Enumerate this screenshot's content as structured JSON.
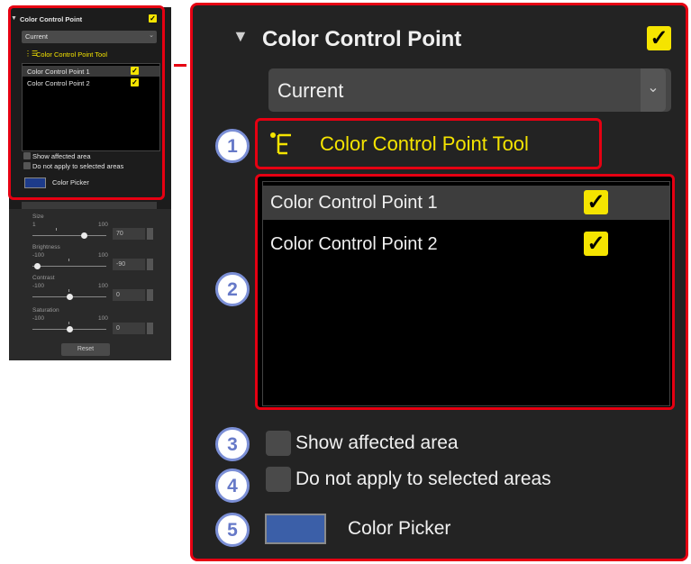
{
  "panel": {
    "title": "Color Control Point",
    "enabled": true,
    "dropdown_value": "Current",
    "tool_label": "Color Control Point Tool",
    "points": [
      {
        "label": "Color Control Point 1",
        "checked": true,
        "selected": true
      },
      {
        "label": "Color Control Point 2",
        "checked": true,
        "selected": false
      }
    ],
    "show_affected_area": "Show affected area",
    "do_not_apply": "Do not apply to selected areas",
    "color_picker_label": "Color Picker",
    "picker_color": "#3b5fa8"
  },
  "sliders": [
    {
      "label": "Size",
      "min": "1",
      "max": "100",
      "value": "70"
    },
    {
      "label": "Brightness",
      "min": "-100",
      "max": "100",
      "value": "-90"
    },
    {
      "label": "Contrast",
      "min": "-100",
      "max": "100",
      "value": "0"
    },
    {
      "label": "Saturation",
      "min": "-100",
      "max": "100",
      "value": "0"
    }
  ],
  "reset_label": "Reset",
  "callouts": [
    "1",
    "2",
    "3",
    "4",
    "5"
  ],
  "colors": {
    "highlight": "#e60012",
    "check": "#f5e400",
    "callout_ring": "#7b8fd6",
    "tool_text": "#f5e400"
  },
  "icons": {
    "collapse": "triangle-down-icon",
    "check": "checkmark-icon",
    "tool": "control-point-tool-icon",
    "dropdown": "chevron-down-icon"
  }
}
